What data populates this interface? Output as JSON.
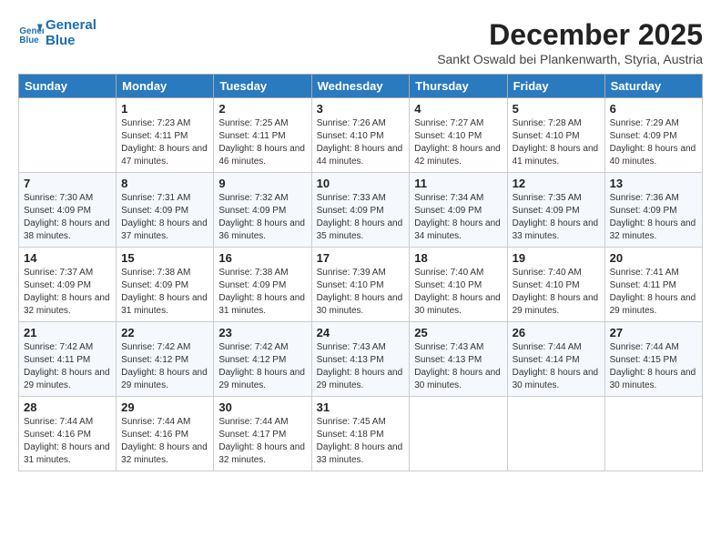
{
  "header": {
    "logo_line1": "General",
    "logo_line2": "Blue",
    "month_year": "December 2025",
    "location": "Sankt Oswald bei Plankenwarth, Styria, Austria"
  },
  "days_of_week": [
    "Sunday",
    "Monday",
    "Tuesday",
    "Wednesday",
    "Thursday",
    "Friday",
    "Saturday"
  ],
  "weeks": [
    [
      {
        "day": "",
        "info": ""
      },
      {
        "day": "1",
        "info": "Sunrise: 7:23 AM\nSunset: 4:11 PM\nDaylight: 8 hours and 47 minutes."
      },
      {
        "day": "2",
        "info": "Sunrise: 7:25 AM\nSunset: 4:11 PM\nDaylight: 8 hours and 46 minutes."
      },
      {
        "day": "3",
        "info": "Sunrise: 7:26 AM\nSunset: 4:10 PM\nDaylight: 8 hours and 44 minutes."
      },
      {
        "day": "4",
        "info": "Sunrise: 7:27 AM\nSunset: 4:10 PM\nDaylight: 8 hours and 42 minutes."
      },
      {
        "day": "5",
        "info": "Sunrise: 7:28 AM\nSunset: 4:10 PM\nDaylight: 8 hours and 41 minutes."
      },
      {
        "day": "6",
        "info": "Sunrise: 7:29 AM\nSunset: 4:09 PM\nDaylight: 8 hours and 40 minutes."
      }
    ],
    [
      {
        "day": "7",
        "info": "Sunrise: 7:30 AM\nSunset: 4:09 PM\nDaylight: 8 hours and 38 minutes."
      },
      {
        "day": "8",
        "info": "Sunrise: 7:31 AM\nSunset: 4:09 PM\nDaylight: 8 hours and 37 minutes."
      },
      {
        "day": "9",
        "info": "Sunrise: 7:32 AM\nSunset: 4:09 PM\nDaylight: 8 hours and 36 minutes."
      },
      {
        "day": "10",
        "info": "Sunrise: 7:33 AM\nSunset: 4:09 PM\nDaylight: 8 hours and 35 minutes."
      },
      {
        "day": "11",
        "info": "Sunrise: 7:34 AM\nSunset: 4:09 PM\nDaylight: 8 hours and 34 minutes."
      },
      {
        "day": "12",
        "info": "Sunrise: 7:35 AM\nSunset: 4:09 PM\nDaylight: 8 hours and 33 minutes."
      },
      {
        "day": "13",
        "info": "Sunrise: 7:36 AM\nSunset: 4:09 PM\nDaylight: 8 hours and 32 minutes."
      }
    ],
    [
      {
        "day": "14",
        "info": "Sunrise: 7:37 AM\nSunset: 4:09 PM\nDaylight: 8 hours and 32 minutes."
      },
      {
        "day": "15",
        "info": "Sunrise: 7:38 AM\nSunset: 4:09 PM\nDaylight: 8 hours and 31 minutes."
      },
      {
        "day": "16",
        "info": "Sunrise: 7:38 AM\nSunset: 4:09 PM\nDaylight: 8 hours and 31 minutes."
      },
      {
        "day": "17",
        "info": "Sunrise: 7:39 AM\nSunset: 4:10 PM\nDaylight: 8 hours and 30 minutes."
      },
      {
        "day": "18",
        "info": "Sunrise: 7:40 AM\nSunset: 4:10 PM\nDaylight: 8 hours and 30 minutes."
      },
      {
        "day": "19",
        "info": "Sunrise: 7:40 AM\nSunset: 4:10 PM\nDaylight: 8 hours and 29 minutes."
      },
      {
        "day": "20",
        "info": "Sunrise: 7:41 AM\nSunset: 4:11 PM\nDaylight: 8 hours and 29 minutes."
      }
    ],
    [
      {
        "day": "21",
        "info": "Sunrise: 7:42 AM\nSunset: 4:11 PM\nDaylight: 8 hours and 29 minutes."
      },
      {
        "day": "22",
        "info": "Sunrise: 7:42 AM\nSunset: 4:12 PM\nDaylight: 8 hours and 29 minutes."
      },
      {
        "day": "23",
        "info": "Sunrise: 7:42 AM\nSunset: 4:12 PM\nDaylight: 8 hours and 29 minutes."
      },
      {
        "day": "24",
        "info": "Sunrise: 7:43 AM\nSunset: 4:13 PM\nDaylight: 8 hours and 29 minutes."
      },
      {
        "day": "25",
        "info": "Sunrise: 7:43 AM\nSunset: 4:13 PM\nDaylight: 8 hours and 30 minutes."
      },
      {
        "day": "26",
        "info": "Sunrise: 7:44 AM\nSunset: 4:14 PM\nDaylight: 8 hours and 30 minutes."
      },
      {
        "day": "27",
        "info": "Sunrise: 7:44 AM\nSunset: 4:15 PM\nDaylight: 8 hours and 30 minutes."
      }
    ],
    [
      {
        "day": "28",
        "info": "Sunrise: 7:44 AM\nSunset: 4:16 PM\nDaylight: 8 hours and 31 minutes."
      },
      {
        "day": "29",
        "info": "Sunrise: 7:44 AM\nSunset: 4:16 PM\nDaylight: 8 hours and 32 minutes."
      },
      {
        "day": "30",
        "info": "Sunrise: 7:44 AM\nSunset: 4:17 PM\nDaylight: 8 hours and 32 minutes."
      },
      {
        "day": "31",
        "info": "Sunrise: 7:45 AM\nSunset: 4:18 PM\nDaylight: 8 hours and 33 minutes."
      },
      {
        "day": "",
        "info": ""
      },
      {
        "day": "",
        "info": ""
      },
      {
        "day": "",
        "info": ""
      }
    ]
  ]
}
